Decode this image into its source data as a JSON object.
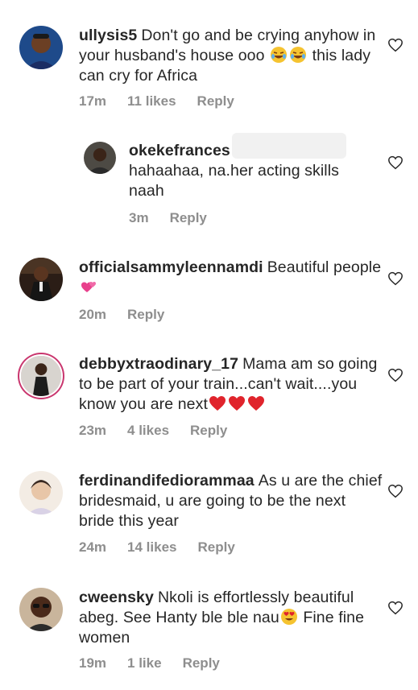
{
  "comments": [
    {
      "username": "ullysis5",
      "text": "Don't go and be crying anyhow in your husband's house ooo",
      "text_after": "this lady can cry for Africa",
      "emoji": [
        "laughing-emoji",
        "laughing-emoji"
      ],
      "time": "17m",
      "likes": "11 likes",
      "reply_label": "Reply"
    },
    {
      "username": "okekefrances",
      "text": "hahaahaa, na.her acting skills naah",
      "time": "3m",
      "reply_label": "Reply",
      "is_reply": true
    },
    {
      "username": "officialsammyleennamdi",
      "text": "Beautiful people",
      "emoji": [
        "two-hearts-emoji"
      ],
      "time": "20m",
      "reply_label": "Reply"
    },
    {
      "username": "debbyxtraodinary_17",
      "text": "Mama am so going to be part of your train...can't wait....you know you are next",
      "emoji": [
        "red-heart-emoji",
        "red-heart-emoji",
        "red-heart-emoji"
      ],
      "time": "23m",
      "likes": "4 likes",
      "reply_label": "Reply"
    },
    {
      "username": "ferdinandifediorammaa",
      "text": "As u are the chief bridesmaid, u are going to be the next bride this year",
      "time": "24m",
      "likes": "14 likes",
      "reply_label": "Reply"
    },
    {
      "username": "cweensky",
      "text": "Nkoli is effortlessly beautiful abeg. See Hanty ble ble nau",
      "text_after": "Fine fine women",
      "emoji": [
        "heart-eyes-emoji"
      ],
      "time": "19m",
      "likes": "1 like",
      "reply_label": "Reply"
    }
  ],
  "colors": {
    "text": "#262626",
    "meta": "#8e8e8e",
    "story_ring": "#c9366e"
  },
  "icons": {
    "like": "heart-outline-icon"
  }
}
